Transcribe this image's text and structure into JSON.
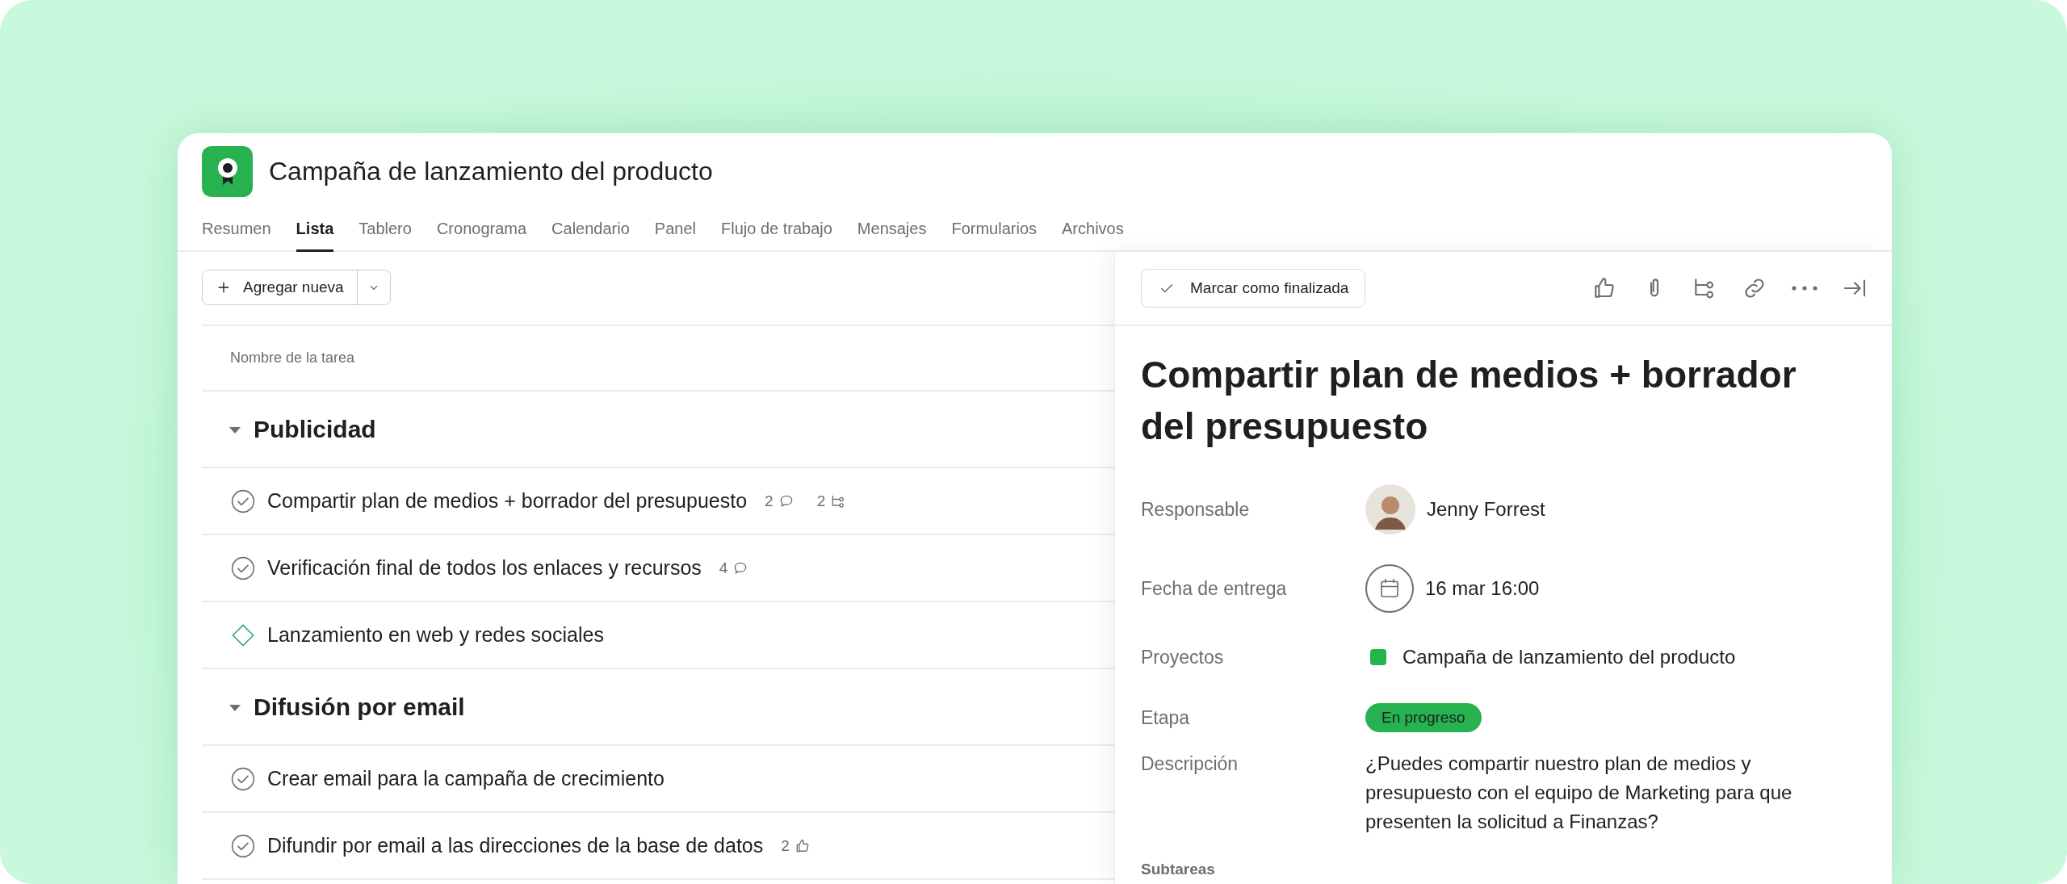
{
  "project": {
    "title": "Campaña de lanzamiento del producto"
  },
  "tabs": [
    {
      "label": "Resumen",
      "selected": false
    },
    {
      "label": "Lista",
      "selected": true
    },
    {
      "label": "Tablero",
      "selected": false
    },
    {
      "label": "Cronograma",
      "selected": false
    },
    {
      "label": "Calendario",
      "selected": false
    },
    {
      "label": "Panel",
      "selected": false
    },
    {
      "label": "Flujo de trabajo",
      "selected": false
    },
    {
      "label": "Mensajes",
      "selected": false
    },
    {
      "label": "Formularios",
      "selected": false
    },
    {
      "label": "Archivos",
      "selected": false
    }
  ],
  "list": {
    "add_button": "Agregar nueva",
    "column_header": "Nombre de la tarea",
    "sections": [
      {
        "title": "Publicidad",
        "expanded": true,
        "tasks": [
          {
            "kind": "task",
            "name": "Compartir plan de medios + borrador del presupuesto",
            "meta": [
              {
                "kind": "comments",
                "count": "2"
              },
              {
                "kind": "subtasks",
                "count": "2"
              }
            ]
          },
          {
            "kind": "task",
            "name": "Verificación final de todos los enlaces y recursos",
            "meta": [
              {
                "kind": "comments",
                "count": "4"
              }
            ]
          },
          {
            "kind": "milestone",
            "name": "Lanzamiento en web y redes sociales"
          }
        ]
      },
      {
        "title": "Difusión por email",
        "expanded": true,
        "tasks": [
          {
            "kind": "task",
            "name": "Crear email para la campaña de crecimiento"
          },
          {
            "kind": "task",
            "name": "Difundir por email a las direcciones de la base de datos",
            "meta": [
              {
                "kind": "likes",
                "count": "2"
              }
            ]
          }
        ]
      }
    ]
  },
  "detail": {
    "complete_button": "Marcar como finalizada",
    "title": "Compartir plan de medios + borrador del presupuesto",
    "fields": [
      {
        "kind": "person",
        "label": "Responsable",
        "value": "Jenny Forrest"
      },
      {
        "kind": "date",
        "label": "Fecha de entrega",
        "value": "16 mar 16:00"
      },
      {
        "kind": "project",
        "label": "Proyectos",
        "value": "Campaña de lanzamiento del producto",
        "color": "#25b24f"
      },
      {
        "kind": "stage",
        "label": "Etapa",
        "value": "En progreso",
        "color": "#25b24f"
      },
      {
        "kind": "text",
        "label": "Descripción",
        "value": "¿Puedes compartir nuestro plan de medios y presupuesto con el equipo de Marketing para que presenten la solicitud a Finanzas?"
      }
    ],
    "subtasks_label": "Subtareas"
  }
}
